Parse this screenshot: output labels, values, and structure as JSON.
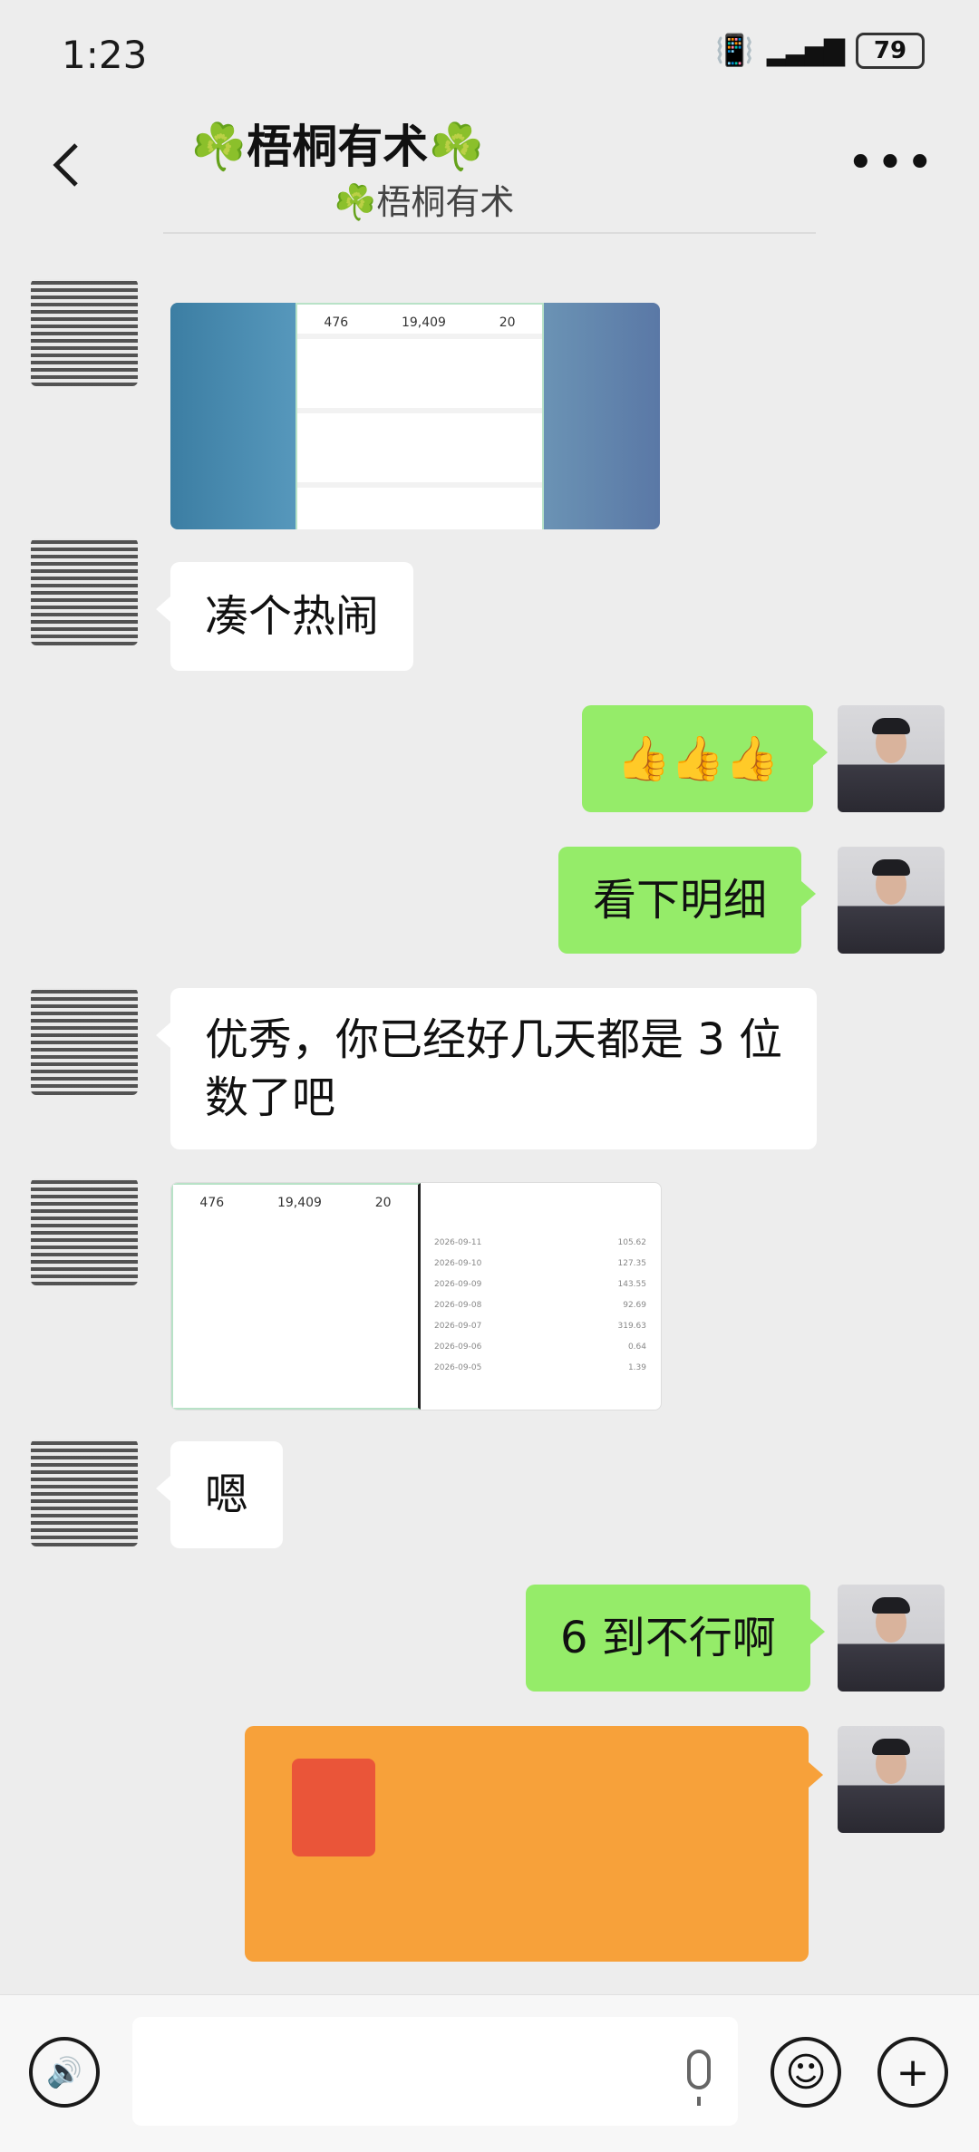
{
  "status_bar": {
    "time": "1:23",
    "battery": "79"
  },
  "header": {
    "title": "☘️梧桐有术☘️",
    "subtitle": "☘️梧桐有术"
  },
  "messages": [
    {
      "side": "other",
      "type": "image"
    },
    {
      "side": "other",
      "type": "text",
      "text": "凑个热闹"
    },
    {
      "side": "self",
      "type": "text",
      "text": "👍👍👍"
    },
    {
      "side": "self",
      "type": "text",
      "text": "看下明细"
    },
    {
      "side": "other",
      "type": "text",
      "lines": [
        "优秀，你已经好几天都是 3 位",
        "数了吧"
      ]
    },
    {
      "side": "other",
      "type": "image"
    },
    {
      "side": "other",
      "type": "text",
      "text": "嗯"
    },
    {
      "side": "self",
      "type": "text",
      "text": "6 到不行啊"
    },
    {
      "side": "self",
      "type": "red-packet"
    }
  ],
  "screenshot_stats": {
    "a": "476",
    "b": "19,409",
    "c": "20"
  },
  "screenshot_list_dates": [
    "2026-09-11",
    "2026-09-10",
    "2026-09-09",
    "2026-09-08",
    "2026-09-07",
    "2026-09-06",
    "2026-09-05"
  ],
  "screenshot_list_values": [
    "105.62",
    "127.35",
    "143.55",
    "92.69",
    "319.63",
    "0.64",
    "1.39"
  ],
  "colors": {
    "self_bubble": "#95ec69",
    "background": "#ededed",
    "red_packet": "#f7a13a"
  }
}
